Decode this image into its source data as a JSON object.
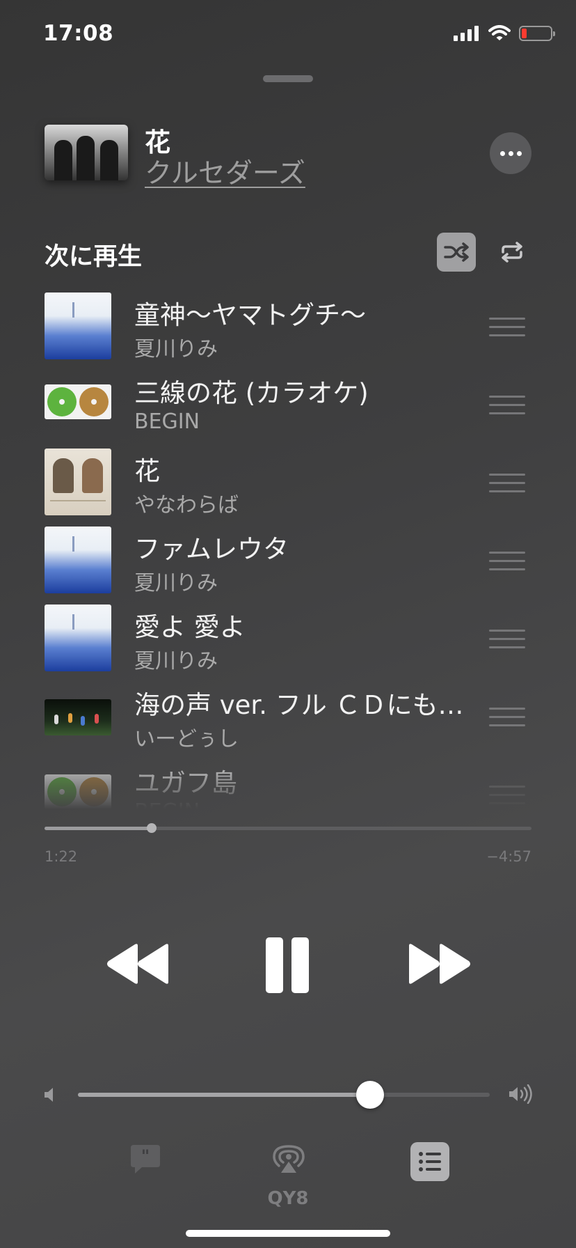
{
  "status_bar": {
    "time": "17:08",
    "battery_level": 0.15,
    "battery_color": "#ff3b30"
  },
  "now_playing": {
    "title": "花",
    "artist": "クルセダーズ"
  },
  "up_next": {
    "heading": "次に再生",
    "shuffle_active": true,
    "repeat_active": false,
    "tracks": [
      {
        "title": "童神〜ヤマトグチ〜",
        "artist": "夏川りみ",
        "art": "blue"
      },
      {
        "title": "三線の花 (カラオケ)",
        "artist": "BEGIN",
        "art": "cd"
      },
      {
        "title": "花",
        "artist": "やなわらば",
        "art": "duo"
      },
      {
        "title": "ファムレウタ",
        "artist": "夏川りみ",
        "art": "blue"
      },
      {
        "title": "愛よ 愛よ",
        "artist": "夏川りみ",
        "art": "blue"
      },
      {
        "title": "海の声 ver. フル ＣＤにも…",
        "artist": "いーどぅし",
        "art": "photo"
      },
      {
        "title": "ユガフ島",
        "artist": "BEGIN",
        "art": "cd"
      }
    ]
  },
  "playback": {
    "elapsed": "1:22",
    "remaining": "−4:57",
    "progress": 0.22,
    "state": "playing"
  },
  "volume": {
    "level": 0.71
  },
  "bottom_bar": {
    "airplay_device": "QY8"
  },
  "colors": {
    "accent_gray": "#a0a0a2",
    "text_secondary": "#a9a9a9"
  }
}
